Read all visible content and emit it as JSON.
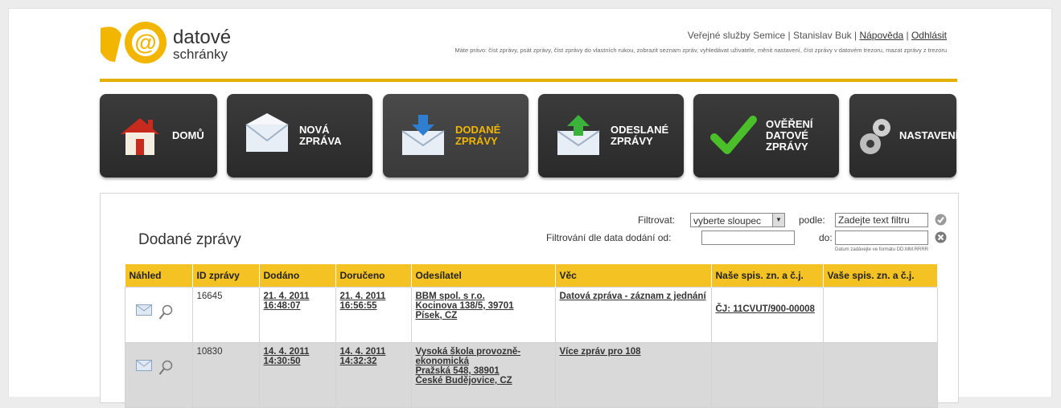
{
  "brand": {
    "line1": "datové",
    "line2": "schránky"
  },
  "header": {
    "org": "Veřejné služby Semice",
    "user": "Stanislav Buk",
    "help": "Nápověda",
    "logout": "Odhlásit",
    "rights": "Máte právo: číst zprávy, psát zprávy, číst zprávy do vlastních rukou, zobrazit seznam zpráv, vyhledávat uživatele, měnit nastavení, číst zprávy v datovém trezoru, mazat zprávy z trezoru"
  },
  "nav": [
    {
      "label": "Domů",
      "icon": "home-icon"
    },
    {
      "label": "Nová zpráva",
      "icon": "new-message-icon"
    },
    {
      "label": "Dodané zprávy",
      "icon": "inbox-icon",
      "active": true
    },
    {
      "label": "Odeslané zprávy",
      "icon": "sent-icon"
    },
    {
      "label": "Ověření datové zprávy",
      "icon": "checkmark-icon"
    },
    {
      "label": "Nastavení",
      "icon": "gear-icon"
    }
  ],
  "panel": {
    "title": "Dodané zprávy",
    "filter_label": "Filtrovat:",
    "filter_select": "vyberte sloupec",
    "by_label": "podle:",
    "filter_placeholder": "Zadejte text filtru",
    "date_label": "Filtrování dle data dodání od:",
    "to_label": "do:",
    "date_hint": "Datum zadávejte ve formátu DD.MM.RRRR"
  },
  "table": {
    "headers": [
      "Náhled",
      "ID zprávy",
      "Dodáno",
      "Doručeno",
      "Odesílatel",
      "Věc",
      "Naše spis. zn. a č.j.",
      "Vaše spis. zn. a č.j."
    ],
    "rows": [
      {
        "id": "16645",
        "delivered_date": "21. 4. 2011",
        "delivered_time": "16:48:07",
        "received_date": "21. 4. 2011",
        "received_time": "16:56:55",
        "sender1": "BBM spol. s r.o.",
        "sender2": "Kocinova 138/5, 39701",
        "sender3": "Písek, CZ",
        "sender4": "",
        "subject": "Datová zpráva - záznam z jednání",
        "our_ref": "ČJ: 11CVUT/900-00008",
        "your_ref": ""
      },
      {
        "id": "10830",
        "delivered_date": "14. 4. 2011",
        "delivered_time": "14:30:50",
        "received_date": "14. 4. 2011",
        "received_time": "14:32:32",
        "sender1": "Vysoká škola provozně-ekonomická",
        "sender2": "Pražská 548, 38901",
        "sender3": "České Budějovice, CZ",
        "sender4": "",
        "subject": "Více zpráv pro 108",
        "our_ref": "",
        "your_ref": ""
      }
    ]
  },
  "colors": {
    "accent": "#f4c222",
    "gold_line": "#e3b000",
    "tile": "#2f2f2f",
    "active_text": "#f2b600"
  }
}
